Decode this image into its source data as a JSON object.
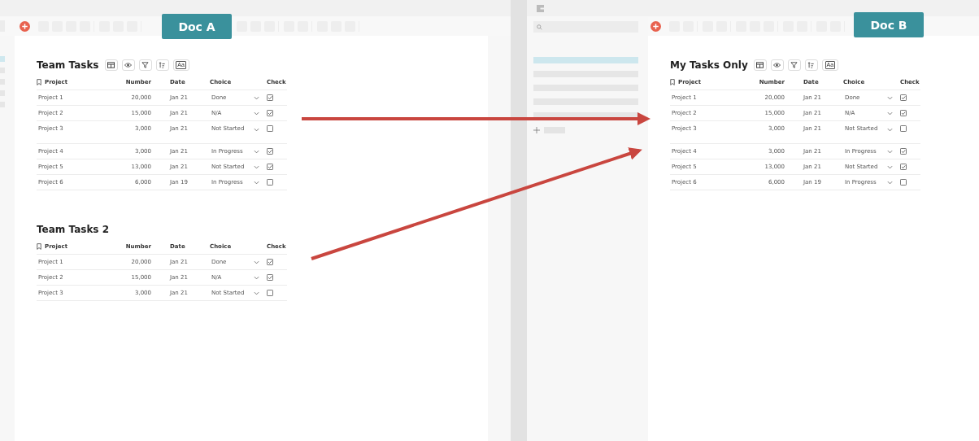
{
  "doc_a": {
    "badge": "Doc A",
    "tables": [
      {
        "title": "Team Tasks",
        "view_buttons": [
          {
            "kind": "table"
          },
          {
            "kind": "eye"
          },
          {
            "kind": "filter"
          },
          {
            "kind": "sort"
          },
          {
            "kind": "text",
            "label": "Aa"
          }
        ],
        "columns": [
          "Project",
          "Number",
          "Date",
          "Choice",
          "Check"
        ],
        "rows": [
          {
            "project": "Project 1",
            "number": "20,000",
            "date": "Jan 21",
            "choice": "Done",
            "checked": true,
            "gap_after": false
          },
          {
            "project": "Project 2",
            "number": "15,000",
            "date": "Jan 21",
            "choice": "N/A",
            "checked": true,
            "gap_after": false
          },
          {
            "project": "Project 3",
            "number": "3,000",
            "date": "Jan 21",
            "choice": "Not Started",
            "checked": false,
            "gap_after": true
          },
          {
            "project": "Project 4",
            "number": "3,000",
            "date": "Jan 21",
            "choice": "In Progress",
            "checked": true,
            "gap_after": false
          },
          {
            "project": "Project 5",
            "number": "13,000",
            "date": "Jan 21",
            "choice": "Not Started",
            "checked": true,
            "gap_after": false
          },
          {
            "project": "Project 6",
            "number": "6,000",
            "date": "Jan 19",
            "choice": "In Progress",
            "checked": false,
            "gap_after": false
          }
        ]
      },
      {
        "title": "Team Tasks 2",
        "columns": [
          "Project",
          "Number",
          "Date",
          "Choice",
          "Check"
        ],
        "rows": [
          {
            "project": "Project 1",
            "number": "20,000",
            "date": "Jan 21",
            "choice": "Done",
            "checked": true,
            "gap_after": false
          },
          {
            "project": "Project 2",
            "number": "15,000",
            "date": "Jan 21",
            "choice": "N/A",
            "checked": true,
            "gap_after": false
          },
          {
            "project": "Project 3",
            "number": "3,000",
            "date": "Jan 21",
            "choice": "Not Started",
            "checked": false,
            "gap_after": false
          }
        ]
      }
    ]
  },
  "doc_b": {
    "badge": "Doc B",
    "sidebar": {
      "items": [
        {
          "selected": true
        },
        {
          "selected": false
        },
        {
          "selected": false
        },
        {
          "selected": false
        },
        {
          "selected": false
        }
      ]
    },
    "tables": [
      {
        "title": "My Tasks Only",
        "view_buttons": [
          {
            "kind": "table"
          },
          {
            "kind": "eye"
          },
          {
            "kind": "filter"
          },
          {
            "kind": "sort"
          },
          {
            "kind": "text",
            "label": "Aa"
          }
        ],
        "columns": [
          "Project",
          "Number",
          "Date",
          "Choice",
          "Check"
        ],
        "rows": [
          {
            "project": "Project 1",
            "number": "20,000",
            "date": "Jan 21",
            "choice": "Done",
            "checked": true,
            "gap_after": false
          },
          {
            "project": "Project 2",
            "number": "15,000",
            "date": "Jan 21",
            "choice": "N/A",
            "checked": true,
            "gap_after": false
          },
          {
            "project": "Project 3",
            "number": "3,000",
            "date": "Jan 21",
            "choice": "Not Started",
            "checked": false,
            "gap_after": true
          },
          {
            "project": "Project 4",
            "number": "3,000",
            "date": "Jan 21",
            "choice": "In Progress",
            "checked": true,
            "gap_after": false
          },
          {
            "project": "Project 5",
            "number": "13,000",
            "date": "Jan 21",
            "choice": "Not Started",
            "checked": true,
            "gap_after": false
          },
          {
            "project": "Project 6",
            "number": "6,000",
            "date": "Jan 19",
            "choice": "In Progress",
            "checked": false,
            "gap_after": false
          }
        ]
      }
    ]
  }
}
